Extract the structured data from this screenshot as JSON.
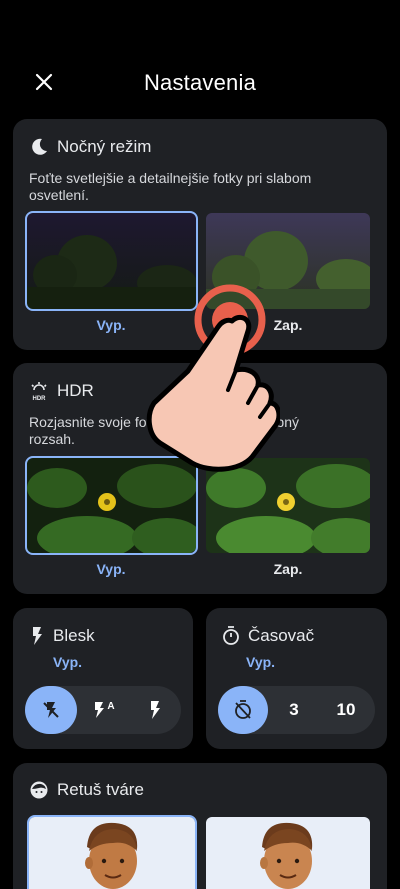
{
  "header": {
    "title": "Nastavenia",
    "close_icon": "close-icon"
  },
  "night_mode": {
    "title": "Nočný režim",
    "description": "Foťte svetlejšie a detailnejšie fotky pri slabom osvetlení.",
    "off_label": "Vyp.",
    "on_label": "Zap.",
    "selected": "off"
  },
  "hdr": {
    "title": "HDR",
    "description": "Rozjasnite svoje fotky a rozšírte ich farebný rozsah.",
    "off_label": "Vyp.",
    "on_label": "Zap.",
    "selected": "off"
  },
  "flash": {
    "title": "Blesk",
    "value": "Vyp.",
    "options": [
      "flash-off-icon",
      "flash-auto-icon",
      "flash-on-icon"
    ],
    "auto_badge": "A"
  },
  "timer": {
    "title": "Časovač",
    "value": "Vyp.",
    "options": [
      "timer-off-icon",
      "3",
      "10"
    ]
  },
  "face_retouch": {
    "title": "Retuš tváre"
  },
  "colors": {
    "accent": "#8ab4f8",
    "card": "#1f2125",
    "tap_indicator": "#e8604c"
  }
}
